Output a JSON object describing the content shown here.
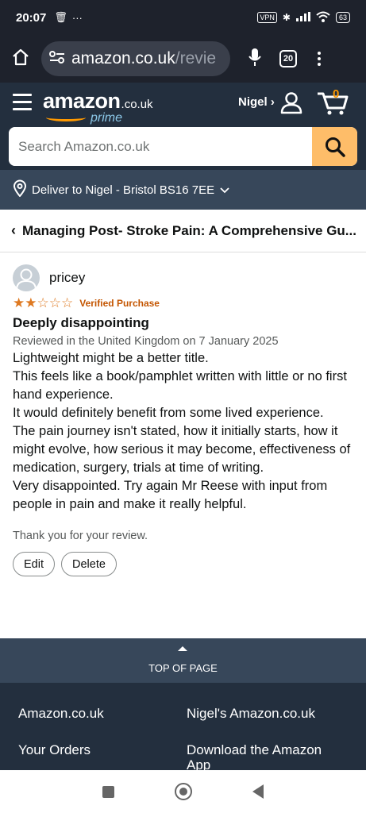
{
  "status_bar": {
    "time": "20:07",
    "vpn": "VPN",
    "battery": "63"
  },
  "browser": {
    "url_host": "amazon.co.uk",
    "url_path": "/revie",
    "tab_count": "20"
  },
  "header": {
    "logo_word": "amazon",
    "logo_tld": ".co.uk",
    "logo_prime": "prime",
    "account_name": "Nigel ›",
    "cart_count": "0",
    "search_placeholder": "Search Amazon.co.uk"
  },
  "deliver_to": "Deliver to Nigel - Bristol BS16 7EE",
  "product_title": "Managing Post- Stroke Pain: A Comprehensive Gu...",
  "review": {
    "reviewer": "pricey",
    "rating": 2,
    "rating_max": 5,
    "verified": "Verified Purchase",
    "title": "Deeply disappointing",
    "date_line": "Reviewed in the United Kingdom on 7 January 2025",
    "body": [
      "Lightweight might be a better title.",
      "This feels like a book/pamphlet written with little or no first hand experience.",
      "It would definitely benefit from some lived experience.",
      "The pain journey isn't stated, how it initially starts, how it might evolve, how serious it may become, effectiveness of medication, surgery, trials at time of writing.",
      "Very disappointed. Try again Mr Reese with input from people in pain and make it really helpful."
    ],
    "thanks": "Thank you for your review.",
    "edit_label": "Edit",
    "delete_label": "Delete"
  },
  "top_of_page": "TOP OF PAGE",
  "footer": {
    "links": [
      "Amazon.co.uk",
      "Nigel's Amazon.co.uk",
      "Your Orders",
      "Download the Amazon App"
    ]
  },
  "colors": {
    "header_bg": "#232f3e",
    "subheader_bg": "#37475a",
    "search_button": "#febd69",
    "star": "#de7921",
    "verified": "#c45500"
  }
}
